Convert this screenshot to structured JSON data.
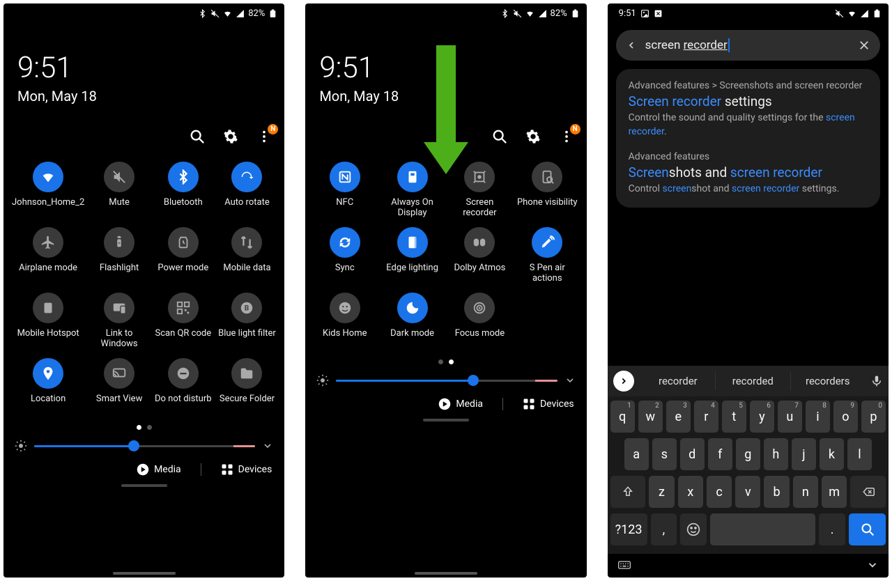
{
  "status": {
    "battery": "82%",
    "time": "9:51"
  },
  "clock": {
    "time": "9:51",
    "date": "Mon, May 18"
  },
  "badge": "N",
  "panels": {
    "a": {
      "tiles": [
        {
          "label": "Johnson_Home_2",
          "on": true,
          "icon": "wifi"
        },
        {
          "label": "Mute",
          "on": false,
          "icon": "mute"
        },
        {
          "label": "Bluetooth",
          "on": true,
          "icon": "bluetooth"
        },
        {
          "label": "Auto rotate",
          "on": true,
          "icon": "rotate"
        },
        {
          "label": "Airplane mode",
          "on": false,
          "icon": "plane"
        },
        {
          "label": "Flashlight",
          "on": false,
          "icon": "flash"
        },
        {
          "label": "Power mode",
          "on": false,
          "icon": "power"
        },
        {
          "label": "Mobile data",
          "on": false,
          "icon": "data"
        },
        {
          "label": "Mobile Hotspot",
          "on": false,
          "icon": "hotspot"
        },
        {
          "label": "Link to Windows",
          "on": false,
          "icon": "link"
        },
        {
          "label": "Scan QR code",
          "on": false,
          "icon": "qr"
        },
        {
          "label": "Blue light filter",
          "on": false,
          "icon": "blf"
        },
        {
          "label": "Location",
          "on": true,
          "icon": "loc"
        },
        {
          "label": "Smart View",
          "on": false,
          "icon": "cast"
        },
        {
          "label": "Do not disturb",
          "on": false,
          "icon": "dnd"
        },
        {
          "label": "Secure Folder",
          "on": false,
          "icon": "folder"
        }
      ],
      "page_active": 0,
      "brightness": 45
    },
    "b": {
      "tiles": [
        {
          "label": "NFC",
          "on": true,
          "icon": "nfc"
        },
        {
          "label": "Always On Display",
          "on": true,
          "icon": "aod"
        },
        {
          "label": "Screen recorder",
          "on": false,
          "icon": "recorder"
        },
        {
          "label": "Phone visibility",
          "on": false,
          "icon": "visibility"
        },
        {
          "label": "Sync",
          "on": true,
          "icon": "sync"
        },
        {
          "label": "Edge lighting",
          "on": true,
          "icon": "edge"
        },
        {
          "label": "Dolby Atmos",
          "on": false,
          "icon": "dolby"
        },
        {
          "label": "S Pen air actions",
          "on": true,
          "icon": "spen"
        },
        {
          "label": "Kids Home",
          "on": false,
          "icon": "kids"
        },
        {
          "label": "Dark mode",
          "on": true,
          "icon": "dark"
        },
        {
          "label": "Focus mode",
          "on": false,
          "icon": "focus"
        }
      ],
      "page_active": 1,
      "brightness": 62
    }
  },
  "footer": {
    "media": "Media",
    "devices": "Devices"
  },
  "search": {
    "query_pre": "screen ",
    "query_under": "recorder",
    "suggestions": [
      "recorder",
      "recorded",
      "recorders"
    ],
    "results": [
      {
        "breadcrumb": "Advanced features > Screenshots and screen recorder",
        "title_hl": "Screen recorder",
        "title_rest": " settings",
        "desc_pre": "Control the sound and quality settings for the ",
        "desc_hl": "screen recorder",
        "desc_post": "."
      },
      {
        "breadcrumb": "Advanced features",
        "title_parts": [
          {
            "t": "Screen",
            "hl": true
          },
          {
            "t": "shots and ",
            "hl": false
          },
          {
            "t": "screen recorder",
            "hl": true
          }
        ],
        "desc_parts": [
          {
            "t": "Control ",
            "hl": false
          },
          {
            "t": "screen",
            "hl": true
          },
          {
            "t": "shot and ",
            "hl": false
          },
          {
            "t": "screen recorder",
            "hl": true
          },
          {
            "t": " settings.",
            "hl": false
          }
        ]
      }
    ]
  },
  "keyboard": {
    "row1": [
      [
        "q",
        "1"
      ],
      [
        "w",
        "2"
      ],
      [
        "e",
        "3"
      ],
      [
        "r",
        "4"
      ],
      [
        "t",
        "5"
      ],
      [
        "y",
        "6"
      ],
      [
        "u",
        "7"
      ],
      [
        "i",
        "8"
      ],
      [
        "o",
        "9"
      ],
      [
        "p",
        "0"
      ]
    ],
    "row2": [
      "a",
      "s",
      "d",
      "f",
      "g",
      "h",
      "j",
      "k",
      "l"
    ],
    "row3": [
      "z",
      "x",
      "c",
      "v",
      "b",
      "n",
      "m"
    ],
    "fn": "?123",
    "comma": ",",
    "period": "."
  }
}
